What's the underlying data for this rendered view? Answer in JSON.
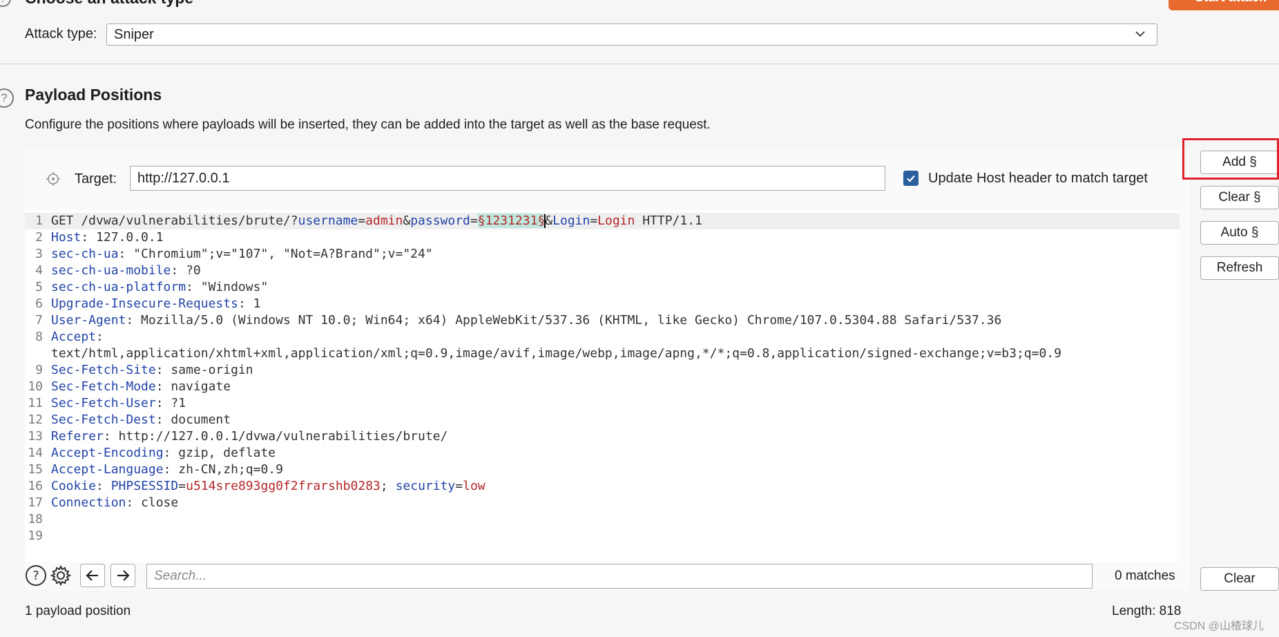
{
  "attack": {
    "section_title": "Choose an attack type",
    "start_label": "Start attack",
    "type_label": "Attack type:",
    "type_value": "Sniper"
  },
  "positions": {
    "title": "Payload Positions",
    "description": "Configure the positions where payloads will be inserted, they can be added into the target as well as the base request.",
    "target_label": "Target:",
    "target_value": "http://127.0.0.1",
    "update_host_label": "Update Host header to match target",
    "update_host_checked": true
  },
  "buttons": {
    "add": "Add §",
    "clear_sect": "Clear §",
    "auto": "Auto §",
    "refresh": "Refresh",
    "clear": "Clear"
  },
  "request_lines": [
    {
      "n": "1",
      "parts": [
        {
          "t": "GET /dvwa/vulnerabilities/brute/?",
          "c": ""
        },
        {
          "t": "username",
          "c": "pname"
        },
        {
          "t": "=",
          "c": ""
        },
        {
          "t": "admin",
          "c": "pval"
        },
        {
          "t": "&",
          "c": ""
        },
        {
          "t": "password",
          "c": "pname"
        },
        {
          "t": "=",
          "c": ""
        },
        {
          "t": "§1231231§",
          "c": "payload"
        },
        {
          "t": "",
          "c": "cursor"
        },
        {
          "t": "&",
          "c": ""
        },
        {
          "t": "Login",
          "c": "pname"
        },
        {
          "t": "=",
          "c": ""
        },
        {
          "t": "Login",
          "c": "pval"
        },
        {
          "t": " HTTP/1.1",
          "c": ""
        }
      ]
    },
    {
      "n": "2",
      "parts": [
        {
          "t": "Host",
          "c": "hname"
        },
        {
          "t": ": 127.0.0.1",
          "c": ""
        }
      ]
    },
    {
      "n": "3",
      "parts": [
        {
          "t": "sec-ch-ua",
          "c": "hname"
        },
        {
          "t": ": \"Chromium\";v=\"107\", \"Not=A?Brand\";v=\"24\"",
          "c": ""
        }
      ]
    },
    {
      "n": "4",
      "parts": [
        {
          "t": "sec-ch-ua-mobile",
          "c": "hname"
        },
        {
          "t": ": ?0",
          "c": ""
        }
      ]
    },
    {
      "n": "5",
      "parts": [
        {
          "t": "sec-ch-ua-platform",
          "c": "hname"
        },
        {
          "t": ": \"Windows\"",
          "c": ""
        }
      ]
    },
    {
      "n": "6",
      "parts": [
        {
          "t": "Upgrade-Insecure-Requests",
          "c": "hname"
        },
        {
          "t": ": 1",
          "c": ""
        }
      ]
    },
    {
      "n": "7",
      "parts": [
        {
          "t": "User-Agent",
          "c": "hname"
        },
        {
          "t": ": Mozilla/5.0 (Windows NT 10.0; Win64; x64) AppleWebKit/537.36 (KHTML, like Gecko) Chrome/107.0.5304.88 Safari/537.36",
          "c": ""
        }
      ]
    },
    {
      "n": "8",
      "parts": [
        {
          "t": "Accept",
          "c": "hname"
        },
        {
          "t": ":",
          "c": ""
        }
      ]
    },
    {
      "n": "",
      "parts": [
        {
          "t": "text/html,application/xhtml+xml,application/xml;q=0.9,image/avif,image/webp,image/apng,*/*;q=0.8,application/signed-exchange;v=b3;q=0.9",
          "c": ""
        }
      ]
    },
    {
      "n": "9",
      "parts": [
        {
          "t": "Sec-Fetch-Site",
          "c": "hname"
        },
        {
          "t": ": same-origin",
          "c": ""
        }
      ]
    },
    {
      "n": "10",
      "parts": [
        {
          "t": "Sec-Fetch-Mode",
          "c": "hname"
        },
        {
          "t": ": navigate",
          "c": ""
        }
      ]
    },
    {
      "n": "11",
      "parts": [
        {
          "t": "Sec-Fetch-User",
          "c": "hname"
        },
        {
          "t": ": ?1",
          "c": ""
        }
      ]
    },
    {
      "n": "12",
      "parts": [
        {
          "t": "Sec-Fetch-Dest",
          "c": "hname"
        },
        {
          "t": ": document",
          "c": ""
        }
      ]
    },
    {
      "n": "13",
      "parts": [
        {
          "t": "Referer",
          "c": "hname"
        },
        {
          "t": ": http://127.0.0.1/dvwa/vulnerabilities/brute/",
          "c": ""
        }
      ]
    },
    {
      "n": "14",
      "parts": [
        {
          "t": "Accept-Encoding",
          "c": "hname"
        },
        {
          "t": ": gzip, deflate",
          "c": ""
        }
      ]
    },
    {
      "n": "15",
      "parts": [
        {
          "t": "Accept-Language",
          "c": "hname"
        },
        {
          "t": ": zh-CN,zh;q=0.9",
          "c": ""
        }
      ]
    },
    {
      "n": "16",
      "parts": [
        {
          "t": "Cookie",
          "c": "hname"
        },
        {
          "t": ": ",
          "c": ""
        },
        {
          "t": "PHPSESSID",
          "c": "pname"
        },
        {
          "t": "=",
          "c": ""
        },
        {
          "t": "u514sre893gg0f2frarshb0283",
          "c": "pval"
        },
        {
          "t": "; ",
          "c": ""
        },
        {
          "t": "security",
          "c": "pname"
        },
        {
          "t": "=",
          "c": ""
        },
        {
          "t": "low",
          "c": "pval"
        }
      ]
    },
    {
      "n": "17",
      "parts": [
        {
          "t": "Connection",
          "c": "hname"
        },
        {
          "t": ": close",
          "c": ""
        }
      ]
    },
    {
      "n": "18",
      "parts": []
    },
    {
      "n": "19",
      "parts": []
    }
  ],
  "search": {
    "placeholder": "Search...",
    "matches": "0 matches"
  },
  "footer": {
    "payload_count": "1 payload position",
    "length": "Length: 818",
    "watermark": "CSDN @山楂球儿"
  },
  "icons": {
    "help": "help-icon",
    "settings": "gear-icon",
    "back": "arrow-left-icon",
    "forward": "arrow-right-icon",
    "target": "crosshair-icon",
    "dropdown": "chevron-down-icon",
    "check": "check-icon"
  },
  "colors": {
    "accent": "#e86a2e",
    "highlight_box": "#e0202a",
    "header_name": "#2244a8",
    "param_value": "#b4262a",
    "payload_bg": "#bfe7dd",
    "checkbox": "#2b5f9e"
  }
}
